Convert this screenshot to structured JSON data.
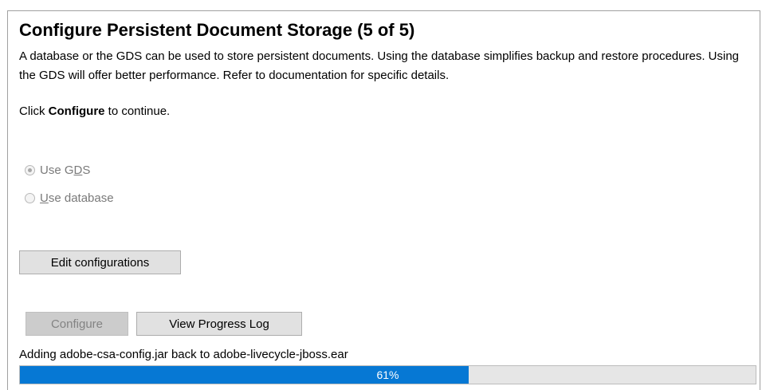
{
  "page": {
    "title": "Configure Persistent Document Storage (5 of 5)",
    "description": "A database or the GDS can be used to store persistent documents. Using the database simplifies backup and restore procedures. Using the GDS will offer better performance. Refer to documentation for specific details.",
    "instruction_prefix": "Click ",
    "instruction_bold": "Configure",
    "instruction_suffix": " to continue."
  },
  "options": [
    {
      "label_pre": "Use G",
      "label_ul": "D",
      "label_post": "S",
      "selected": true,
      "enabled": false
    },
    {
      "label_pre": "",
      "label_ul": "U",
      "label_post": "se database",
      "selected": false,
      "enabled": false
    }
  ],
  "buttons": {
    "edit_configurations": "Edit configurations",
    "configure": "Configure",
    "view_progress_log": "View Progress Log"
  },
  "status": {
    "message": "Adding adobe-csa-config.jar back to adobe-livecycle-jboss.ear",
    "progress_percent": 61,
    "progress_label": "61%"
  },
  "colors": {
    "progress_fill": "#0678d4",
    "progress_track": "#e6e6e6"
  }
}
